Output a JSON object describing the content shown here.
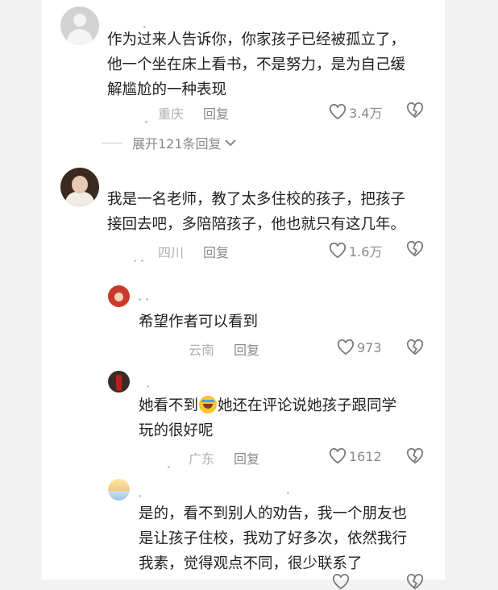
{
  "comments": [
    {
      "lines": [
        "作为过来人告诉你，你家孩子已经被孤立了，",
        "他一个坐在床上看书，不是努力，是为自己缓",
        "解尴尬的一种表现"
      ],
      "region": "重庆",
      "reply_label": "回复",
      "likes": "3.4万"
    },
    {
      "lines": [
        "我是一名老师，教了太多住校的孩子，把孩子",
        "接回去吧，多陪陪孩子，他也就只有这几年。"
      ],
      "region": "四川",
      "reply_label": "回复",
      "likes": "1.6万"
    }
  ],
  "expand_label": "展开121条回复",
  "replies": [
    {
      "lines": [
        "希望作者可以看到"
      ],
      "region": "云南",
      "reply_label": "回复",
      "likes": "973"
    },
    {
      "line1_a": "她看不到",
      "line1_b": "她还在评论说她孩子跟同学",
      "line2": "玩的很好呢",
      "region": "广东",
      "reply_label": "回复",
      "likes": "1612"
    },
    {
      "lines": [
        "是的，看不到别人的劝告，我一个朋友也",
        "是让孩子住校，我劝了好多次，依然我行",
        "我素，觉得观点不同，很少联系了"
      ]
    }
  ]
}
